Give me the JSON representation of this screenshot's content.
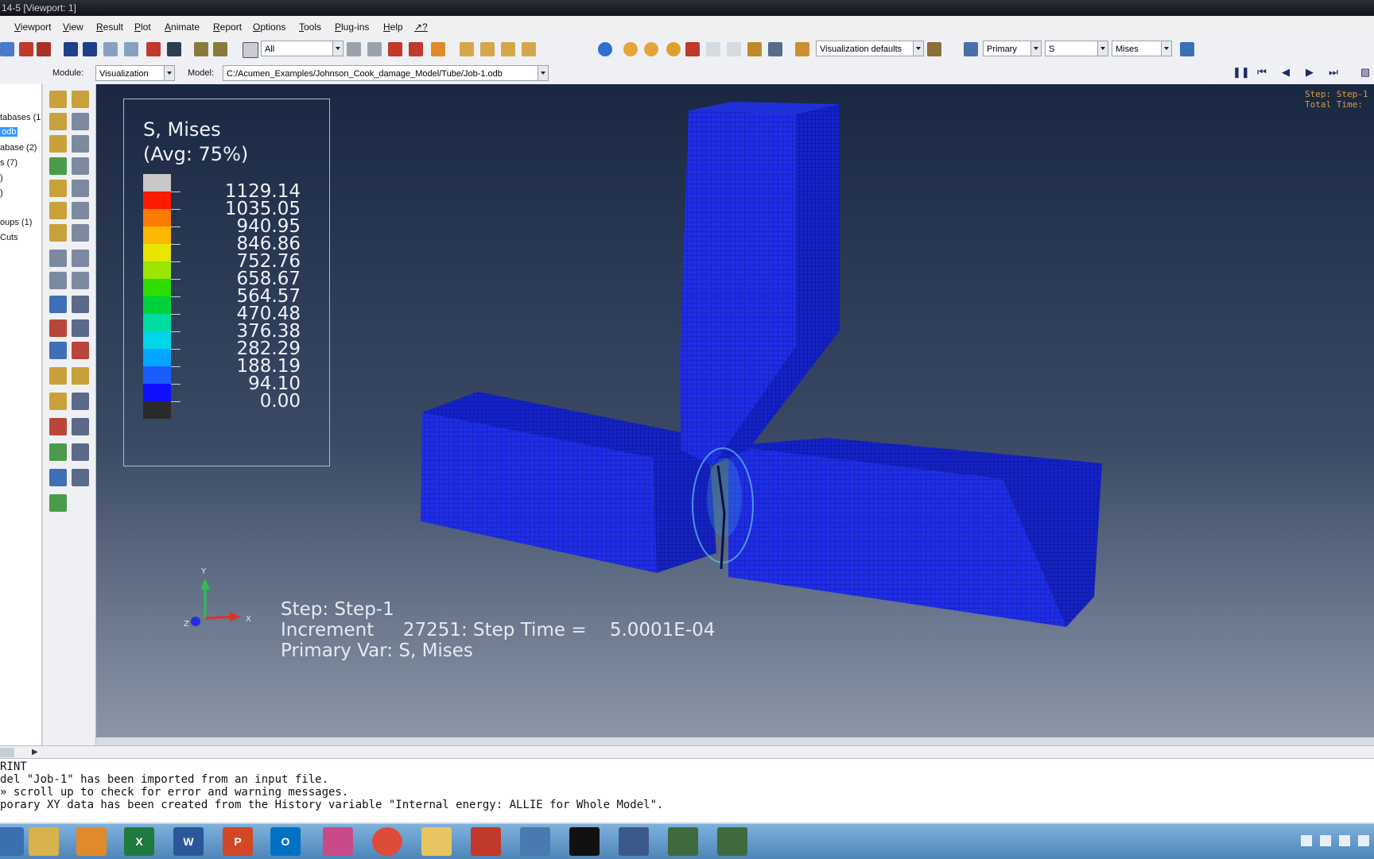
{
  "window": {
    "title": "14-5 [Viewport: 1]"
  },
  "menu": [
    "Viewport",
    "View",
    "Result",
    "Plot",
    "Animate",
    "Report",
    "Options",
    "Tools",
    "Plug-ins",
    "Help",
    "↗?"
  ],
  "toolbar": {
    "selection_filter": "All",
    "view_style": "Visualization defaults",
    "field_output": {
      "type": "Primary",
      "variable": "S",
      "component": "Mises"
    }
  },
  "context": {
    "module_label": "Module:",
    "module_value": "Visualization",
    "model_label": "Model:",
    "model_value": "C:/Acumen_Examples/Johnson_Cook_damage_Model/Tube/Job-1.odb"
  },
  "tree": {
    "items": [
      "tabases (1",
      "odb",
      "abase (2)",
      "s (7)",
      ")",
      ")",
      "oups (1)",
      "Cuts"
    ],
    "selected_index": 1
  },
  "legend": {
    "title": "S, Mises",
    "subtitle": "(Avg: 75%)",
    "values": [
      "1129.14",
      "1035.05",
      "940.95",
      "846.86",
      "752.76",
      "658.67",
      "564.57",
      "470.48",
      "376.38",
      "282.29",
      "188.19",
      "94.10",
      "0.00"
    ],
    "colors": [
      "#c8c8c8",
      "#ff1a00",
      "#ff7a00",
      "#ffb800",
      "#e6e600",
      "#9ae600",
      "#2fdc00",
      "#00d23c",
      "#00dca0",
      "#00d6e6",
      "#00a6ff",
      "#1a5dff",
      "#1010ff",
      "#2a2a2a"
    ]
  },
  "viewport": {
    "step_line": "Step: Step-1",
    "increment_line": "Increment     27251: Step Time =    5.0001E-04",
    "primary_line": "Primary Var: S, Mises",
    "corner_text": [
      "Step: Step-1",
      "Total Time: "
    ],
    "triad": {
      "y": "Y",
      "x": "X",
      "z": "Z"
    },
    "model_colors": {
      "mesh_blue": "#1f2ee6",
      "mesh_dark": "#0f1aa8",
      "failure": "#5fb8e8"
    }
  },
  "messages": [
    "RINT",
    "del \"Job-1\" has been imported from an input file.",
    "» scroll up to check for error and warning messages.",
    "porary XY data has been created from the History variable \"Internal energy: ALLIE for Whole Model\"."
  ],
  "taskbar": {
    "apps": [
      "explorer-icon",
      "media-player-icon",
      "excel-icon",
      "word-icon",
      "powerpoint-icon",
      "outlook-icon",
      "snipping-icon",
      "chrome-icon",
      "folder-icon",
      "acrobat-icon",
      "settings-icon",
      "cmd-icon",
      "network-icon",
      "abaqus-icon",
      "abaqus-cae-icon"
    ]
  }
}
